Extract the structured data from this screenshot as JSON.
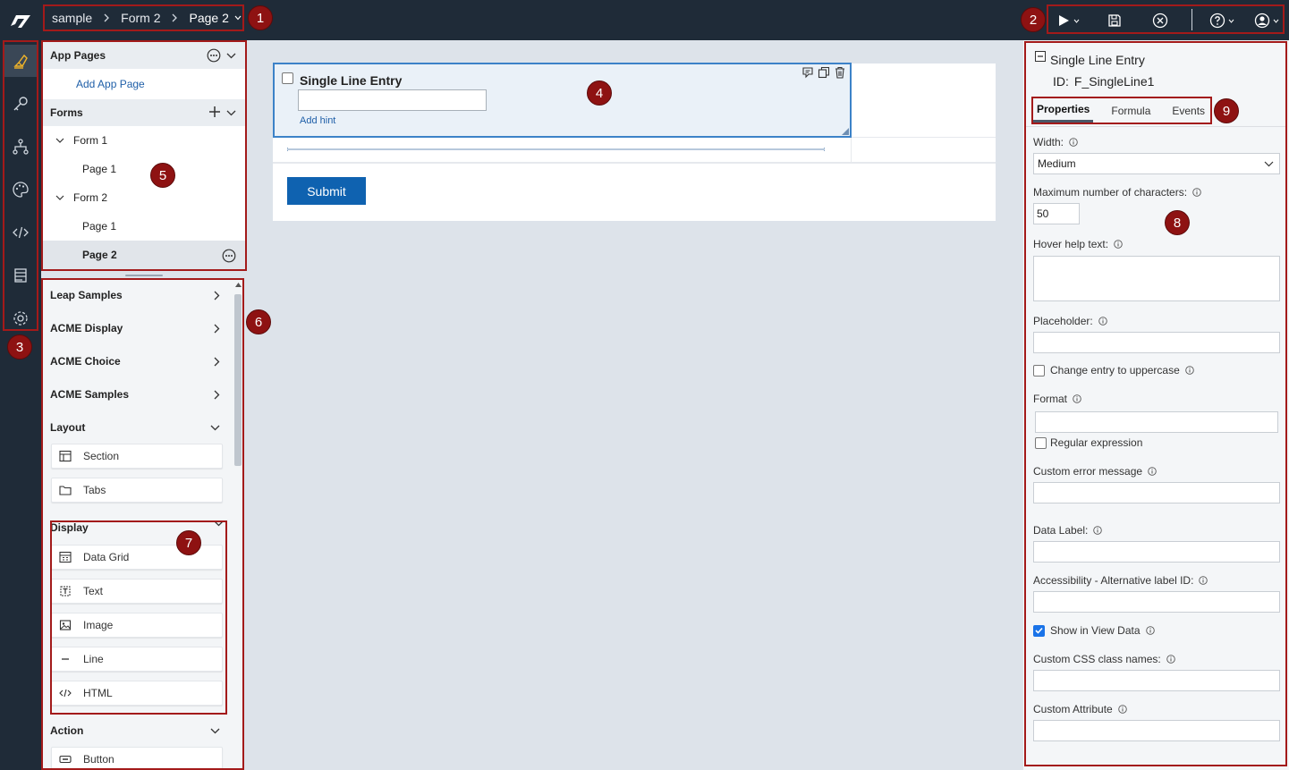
{
  "breadcrumb": {
    "items": [
      "sample",
      "Form 2",
      "Page 2"
    ]
  },
  "badges": [
    "1",
    "2",
    "3",
    "4",
    "5",
    "6",
    "7",
    "8",
    "9"
  ],
  "tree": {
    "app_pages_header": "App Pages",
    "add_app_page": "Add App Page",
    "forms_header": "Forms",
    "items": [
      {
        "label": "Form 1"
      },
      {
        "label": "Page 1"
      },
      {
        "label": "Form 2"
      },
      {
        "label": "Page 1"
      },
      {
        "label": "Page 2"
      }
    ]
  },
  "palette": {
    "categories": {
      "leap": "Leap Samples",
      "acme_display": "ACME Display",
      "acme_choice": "ACME Choice",
      "acme_samples": "ACME Samples",
      "layout": "Layout",
      "display": "Display",
      "action": "Action"
    },
    "layout_items": [
      "Section",
      "Tabs"
    ],
    "display_items": [
      "Data Grid",
      "Text",
      "Image",
      "Line",
      "HTML"
    ],
    "action_items": [
      "Button"
    ]
  },
  "canvas": {
    "field_title": "Single Line Entry",
    "add_hint": "Add hint",
    "submit_label": "Submit"
  },
  "properties": {
    "title": "Single Line Entry",
    "id_label": "ID:",
    "id_value": "F_SingleLine1",
    "tabs": [
      "Properties",
      "Formula",
      "Events"
    ],
    "width_label": "Width:",
    "width_value": "Medium",
    "maxchars_label": "Maximum number of characters:",
    "maxchars_value": "50",
    "hover_label": "Hover help text:",
    "placeholder_label": "Placeholder:",
    "uppercase_label": "Change entry to uppercase",
    "format_label": "Format",
    "regex_label": "Regular expression",
    "custom_error_label": "Custom error message",
    "data_label_label": "Data Label:",
    "accessibility_label": "Accessibility - Alternative label ID:",
    "show_view_label": "Show in View Data",
    "css_label": "Custom CSS class names:",
    "attr_label": "Custom Attribute"
  }
}
